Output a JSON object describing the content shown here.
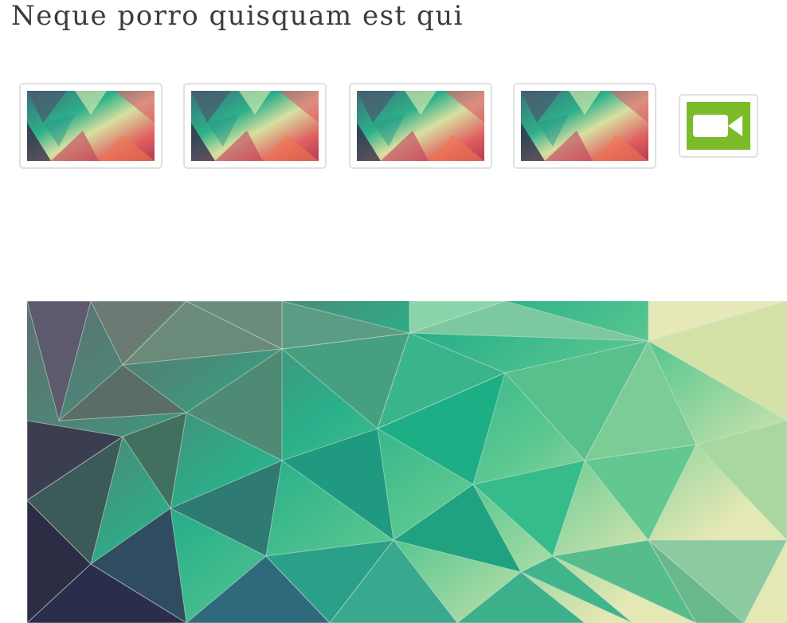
{
  "product": {
    "title": "Neque porro quisquam est qui"
  },
  "gallery": {
    "thumbnails": [
      {
        "type": "image",
        "icon": "polygon-image"
      },
      {
        "type": "image",
        "icon": "polygon-image"
      },
      {
        "type": "image",
        "icon": "polygon-image"
      },
      {
        "type": "image",
        "icon": "polygon-image"
      },
      {
        "type": "video",
        "icon": "video-camera-icon",
        "color": "#7cbb2a"
      }
    ],
    "main_image": {
      "icon": "polygon-image"
    }
  }
}
